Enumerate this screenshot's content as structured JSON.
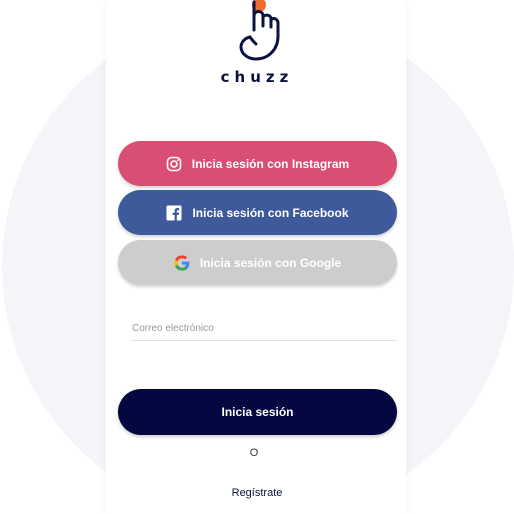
{
  "logo": {
    "text": "chuzz",
    "accent_color": "#f26a2e",
    "ink_color": "#0c1240"
  },
  "social_buttons": {
    "instagram": {
      "label": "Inicia sesión con Instagram",
      "icon": "instagram-icon",
      "color": "#d94f74"
    },
    "facebook": {
      "label": "Inicia sesión con Facebook",
      "icon": "facebook-icon",
      "color": "#3e5a9b"
    },
    "google": {
      "label": "Inicia sesión con Google",
      "icon": "google-icon",
      "color": "#cdcdcd"
    }
  },
  "email": {
    "placeholder": "Correo electrónico",
    "value": ""
  },
  "login": {
    "label": "Inicia sesión",
    "color": "#050840"
  },
  "or_text": "O",
  "register": {
    "label": "Regístrate"
  }
}
